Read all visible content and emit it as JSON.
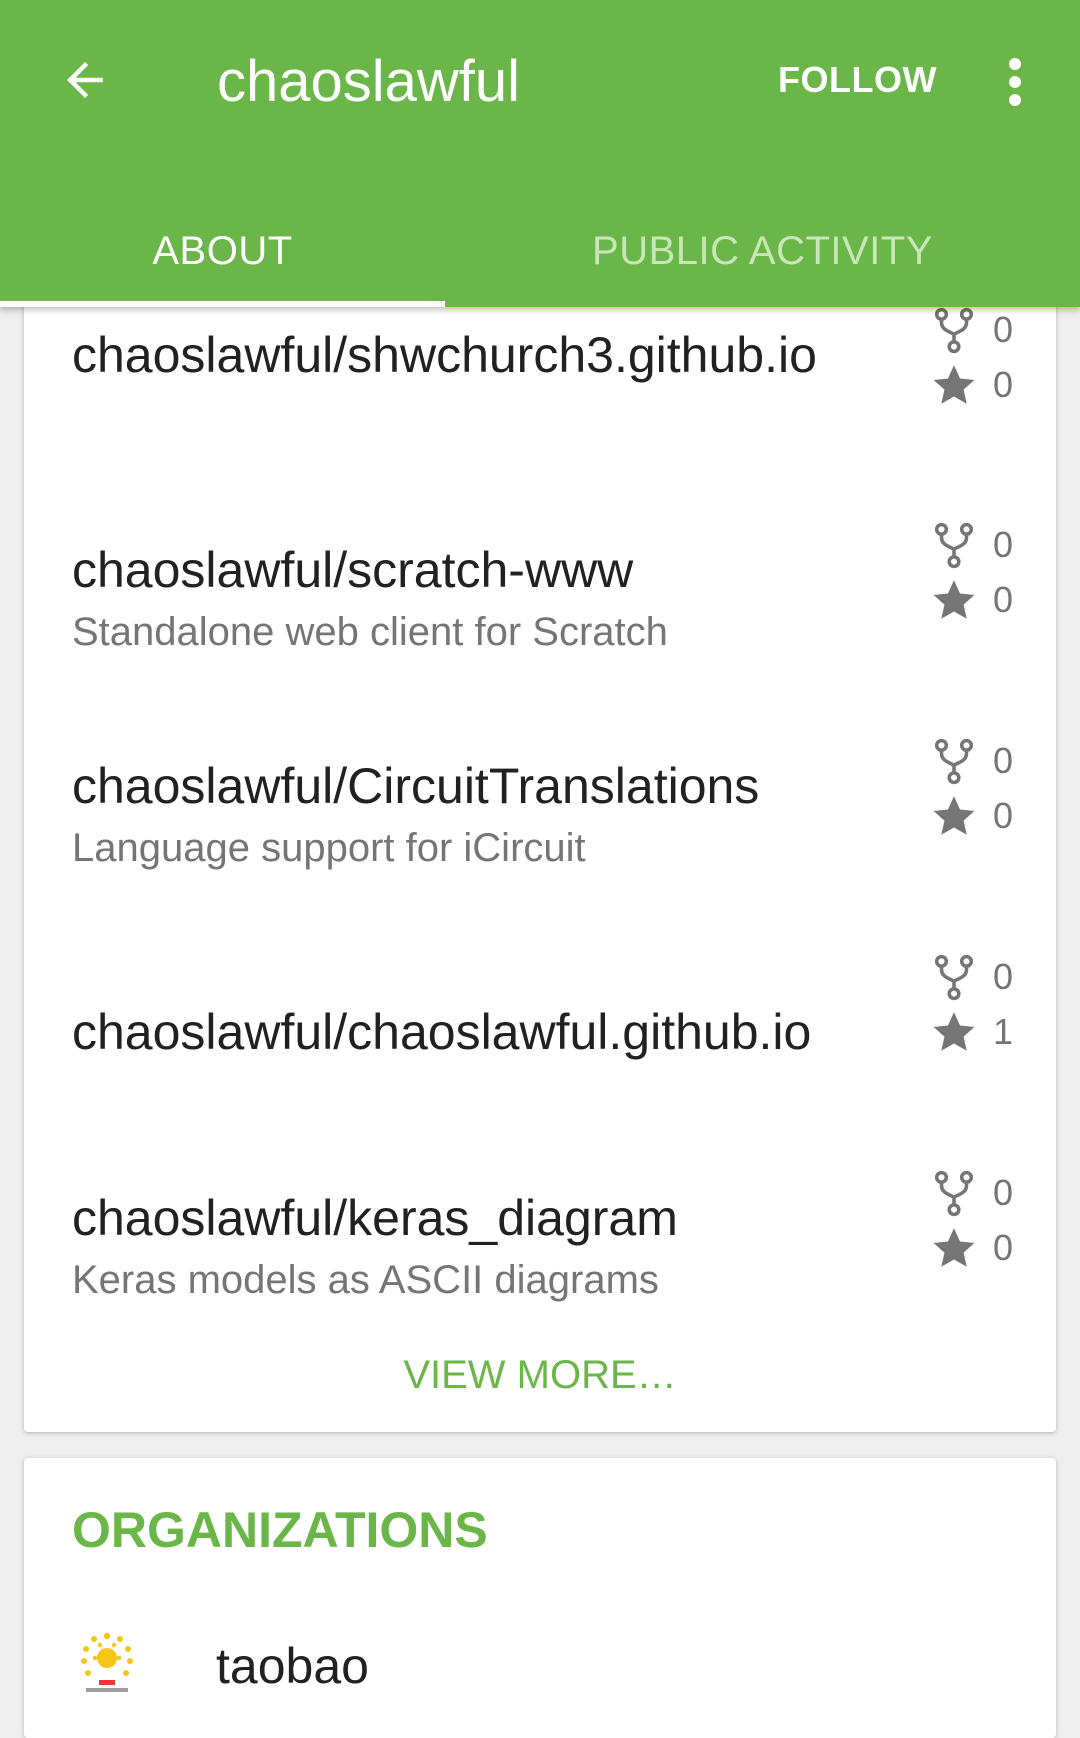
{
  "app_bar": {
    "title": "chaoslawful",
    "follow_label": "FOLLOW",
    "accent_color": "#6ab648",
    "icons": [
      "arrow-back-icon",
      "more-vert-icon"
    ]
  },
  "tabs": [
    {
      "label": "ABOUT",
      "selected": true
    },
    {
      "label": "PUBLIC ACTIVITY",
      "selected": false
    }
  ],
  "repositories": [
    {
      "name": "chaoslawful/shwchurch3.github.io",
      "description": "",
      "forks": "0",
      "stars": "0"
    },
    {
      "name": "chaoslawful/scratch-www",
      "description": "Standalone web client for Scratch",
      "forks": "0",
      "stars": "0"
    },
    {
      "name": "chaoslawful/CircuitTranslations",
      "description": "Language support for iCircuit",
      "forks": "0",
      "stars": "0"
    },
    {
      "name": "chaoslawful/chaoslawful.github.io",
      "description": "",
      "forks": "0",
      "stars": "1"
    },
    {
      "name": "chaoslawful/keras_diagram",
      "description": "Keras models as ASCII diagrams",
      "forks": "0",
      "stars": "0"
    }
  ],
  "view_more_label": "VIEW MORE…",
  "organizations": {
    "heading": "ORGANIZATIONS",
    "items": [
      {
        "name": "taobao",
        "logo_icon": "taobao-open-source-logo"
      }
    ]
  }
}
